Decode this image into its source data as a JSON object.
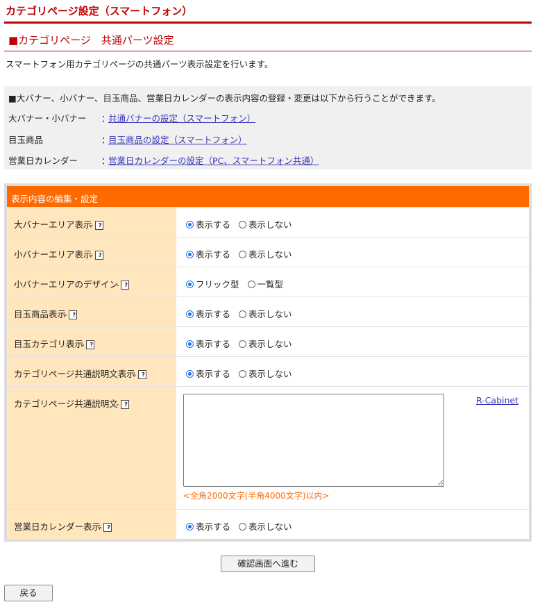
{
  "page_title": "カテゴリページ設定（スマートフォン）",
  "section_title": "■カテゴリページ　共通パーツ設定",
  "description": "スマートフォン用カテゴリページの共通パーツ表示設定を行います。",
  "info": {
    "note": "■大バナー、小バナー、目玉商品、営業日カレンダーの表示内容の登録・変更は以下から行うことができます。",
    "rows": [
      {
        "label": "大バナー・小バナー",
        "sep": "：",
        "link": "共通バナーの設定（スマートフォン）"
      },
      {
        "label": "目玉商品",
        "sep": "：",
        "link": "目玉商品の設定（スマートフォン）"
      },
      {
        "label": "営業日カレンダー",
        "sep": "：",
        "link": "営業日カレンダーの設定（PC、スマートフォン共通）"
      }
    ]
  },
  "form": {
    "header": "表示内容の編集・設定",
    "help_icon": "?",
    "rows": [
      {
        "label": "大バナーエリア表示",
        "opt1": "表示する",
        "opt2": "表示しない",
        "selected": 1
      },
      {
        "label": "小バナーエリア表示",
        "opt1": "表示する",
        "opt2": "表示しない",
        "selected": 1
      },
      {
        "label": "小バナーエリアのデザイン",
        "opt1": "フリック型",
        "opt2": "一覧型",
        "selected": 1
      },
      {
        "label": "目玉商品表示",
        "opt1": "表示する",
        "opt2": "表示しない",
        "selected": 1
      },
      {
        "label": "目玉カテゴリ表示",
        "opt1": "表示する",
        "opt2": "表示しない",
        "selected": 1
      },
      {
        "label": "カテゴリページ共通説明文表示",
        "opt1": "表示する",
        "opt2": "表示しない",
        "selected": 1
      }
    ],
    "text_row": {
      "label": "カテゴリページ共通説明文",
      "textarea_value": "",
      "cabinet_link": "R-Cabinet",
      "limit_note": "<全角2000文字(半角4000文字)以内>"
    },
    "last_row": {
      "label": "営業日カレンダー表示",
      "opt1": "表示する",
      "opt2": "表示しない",
      "selected": 1
    }
  },
  "buttons": {
    "confirm": "確認画面へ進む",
    "back": "戻る"
  },
  "colors": {
    "title_red": "#c00000",
    "header_orange": "#ff6a00",
    "label_bg": "#ffe6bd",
    "link": "#3a37b8",
    "radio_selected": "#1a73e8"
  }
}
